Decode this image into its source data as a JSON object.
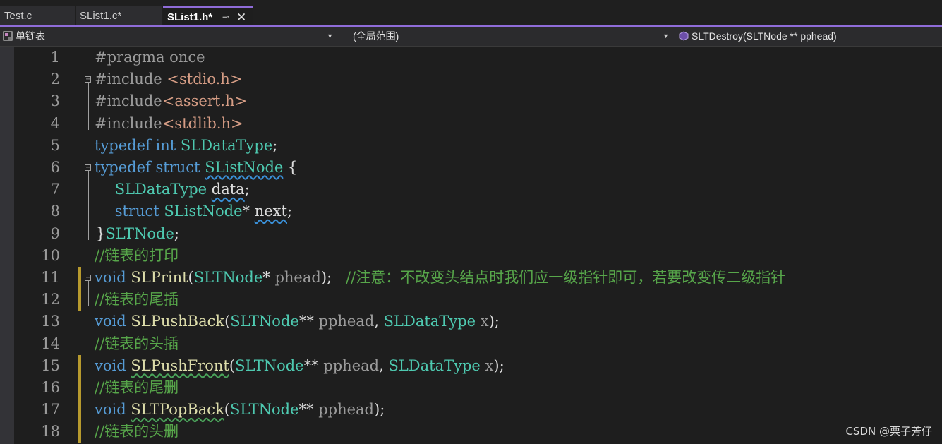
{
  "tabs": [
    {
      "label": "Test.c"
    },
    {
      "label": "SList1.c*"
    },
    {
      "label": "SList1.h*",
      "pin": "⊸",
      "close": "✕"
    }
  ],
  "nav": {
    "project": "单链表",
    "scope": "(全局范围)",
    "member": "SLTDestroy(SLTNode ** pphead)"
  },
  "lines": [
    {
      "n": "1",
      "t": [
        [
          "#pragma once",
          "pp"
        ]
      ]
    },
    {
      "n": "2",
      "t": [
        [
          "#include ",
          "pp"
        ],
        [
          "<stdio.h>",
          "str"
        ]
      ]
    },
    {
      "n": "3",
      "t": [
        [
          "#include",
          "pp"
        ],
        [
          "<assert.h>",
          "str"
        ]
      ]
    },
    {
      "n": "4",
      "t": [
        [
          "#include",
          "pp"
        ],
        [
          "<stdlib.h>",
          "str"
        ]
      ]
    },
    {
      "n": "5",
      "t": [
        [
          "typedef",
          "kw"
        ],
        [
          " ",
          ""
        ],
        [
          "int",
          "kw"
        ],
        [
          " ",
          ""
        ],
        [
          "SLDataType",
          "ty"
        ],
        [
          ";",
          ""
        ]
      ]
    },
    {
      "n": "6",
      "t": [
        [
          "typedef",
          "kw"
        ],
        [
          " ",
          ""
        ],
        [
          "struct",
          "kw"
        ],
        [
          " ",
          ""
        ],
        [
          "SListNode",
          "ty squig"
        ],
        [
          " {",
          ""
        ]
      ]
    },
    {
      "n": "7",
      "t": [
        [
          "    ",
          ""
        ],
        [
          "SLDataType",
          "ty"
        ],
        [
          " ",
          ""
        ],
        [
          "data",
          "squig"
        ],
        [
          ";",
          ""
        ]
      ]
    },
    {
      "n": "8",
      "t": [
        [
          "    ",
          ""
        ],
        [
          "struct",
          "kw"
        ],
        [
          " ",
          ""
        ],
        [
          "SListNode",
          "ty"
        ],
        [
          "* ",
          ""
        ],
        [
          "next",
          "squig"
        ],
        [
          ";",
          ""
        ]
      ]
    },
    {
      "n": "9",
      "t": [
        [
          "}",
          ""
        ],
        [
          "SLTNode",
          "ty"
        ],
        [
          ";",
          ""
        ]
      ]
    },
    {
      "n": "10",
      "t": [
        [
          "//链表的打印",
          "cm"
        ]
      ]
    },
    {
      "n": "11",
      "t": [
        [
          "void",
          "kw"
        ],
        [
          " ",
          ""
        ],
        [
          "SLPrint",
          "fn"
        ],
        [
          "(",
          ""
        ],
        [
          "SLTNode",
          "ty"
        ],
        [
          "* ",
          ""
        ],
        [
          "phead",
          "pp"
        ],
        [
          ");   ",
          ""
        ],
        [
          "//注意：不改变头结点时我们应一级指针即可，若要改变传二级指针",
          "cm"
        ]
      ]
    },
    {
      "n": "12",
      "t": [
        [
          "//链表的尾插",
          "cm"
        ]
      ]
    },
    {
      "n": "13",
      "t": [
        [
          "void",
          "kw"
        ],
        [
          " ",
          ""
        ],
        [
          "SLPushBack",
          "fn"
        ],
        [
          "(",
          ""
        ],
        [
          "SLTNode",
          "ty"
        ],
        [
          "** ",
          ""
        ],
        [
          "pphead",
          "pp"
        ],
        [
          ", ",
          ""
        ],
        [
          "SLDataType",
          "ty"
        ],
        [
          " ",
          ""
        ],
        [
          "x",
          "pp"
        ],
        [
          ");",
          ""
        ]
      ]
    },
    {
      "n": "14",
      "t": [
        [
          "//链表的头插",
          "cm"
        ]
      ]
    },
    {
      "n": "15",
      "t": [
        [
          "void",
          "kw"
        ],
        [
          " ",
          ""
        ],
        [
          "SLPushFront",
          "fn squig-g"
        ],
        [
          "(",
          ""
        ],
        [
          "SLTNode",
          "ty"
        ],
        [
          "** ",
          ""
        ],
        [
          "pphead",
          "pp"
        ],
        [
          ", ",
          ""
        ],
        [
          "SLDataType",
          "ty"
        ],
        [
          " ",
          ""
        ],
        [
          "x",
          "pp"
        ],
        [
          ");",
          ""
        ]
      ]
    },
    {
      "n": "16",
      "t": [
        [
          "//链表的尾删",
          "cm"
        ]
      ]
    },
    {
      "n": "17",
      "t": [
        [
          "void",
          "kw"
        ],
        [
          " ",
          ""
        ],
        [
          "SLTPopBack",
          "fn squig-g"
        ],
        [
          "(",
          ""
        ],
        [
          "SLTNode",
          "ty"
        ],
        [
          "** ",
          ""
        ],
        [
          "pphead",
          "pp"
        ],
        [
          ");",
          ""
        ]
      ]
    },
    {
      "n": "18",
      "t": [
        [
          "//链表的头删",
          "cm"
        ]
      ]
    }
  ],
  "markers": [
    "11",
    "12",
    "15",
    "16",
    "17",
    "18"
  ],
  "watermark": "CSDN @栗子芳仔",
  "colors": {
    "accent": "#8f6cd9",
    "keyword": "#569cd6",
    "type": "#4ec9b0",
    "function": "#dcdcaa",
    "comment": "#57a64a",
    "string": "#d69d85",
    "change_marker": "#b79a2e"
  }
}
